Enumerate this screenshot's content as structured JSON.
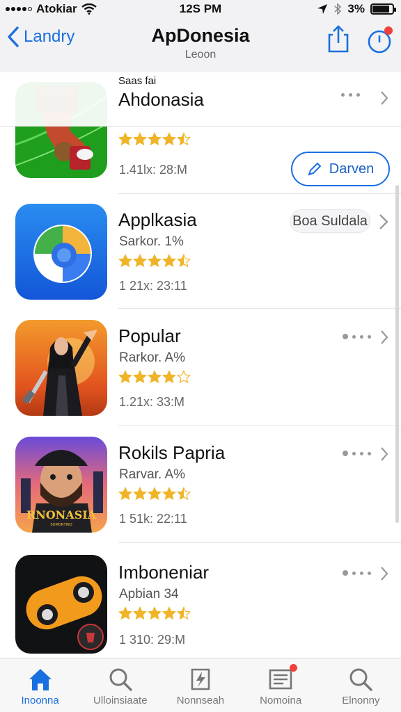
{
  "status_bar": {
    "carrier": "Atokiar",
    "time": "12S PM",
    "battery_text": "3%",
    "battery_level": 0.85
  },
  "nav": {
    "back_label": "Landry",
    "title": "ApDonesia",
    "subtitle": "Leoon"
  },
  "sticky_header": {
    "small_label": "Saas fai",
    "title": "Ahdonasia"
  },
  "apps": [
    {
      "name": "",
      "subtitle": "",
      "meta": "1.41lx: 28:M",
      "rating": 4.5,
      "action": "Darven",
      "icon": "socks-gift-icon"
    },
    {
      "name": "Applkasia",
      "subtitle": "Sarkor. 1%",
      "meta": "1 21x: 23:11",
      "rating": 4.5,
      "action": "Boa Suldala",
      "icon": "browser-swirl-icon"
    },
    {
      "name": "Popular",
      "subtitle": "Rarkor. A%",
      "meta": "1.21x: 33:M",
      "rating": 4,
      "action": "",
      "icon": "sorceress-icon"
    },
    {
      "name": "Rokils Papria",
      "subtitle": "Rarvar. A%",
      "meta": "1 51k: 22:11",
      "rating": 4.5,
      "action": "",
      "icon": "bearded-man-icon",
      "icon_text": "RNONASIA",
      "icon_subtext": "SOMONTINO"
    },
    {
      "name": "Imboneniar",
      "subtitle": "Apbian 34",
      "meta": "1 310: 29:M",
      "rating": 4.5,
      "action": "",
      "icon": "capsule-eyes-icon"
    }
  ],
  "tabs": [
    {
      "label": "Inoonna",
      "icon": "home-icon",
      "active": true
    },
    {
      "label": "Ulloinsiaate",
      "icon": "search-icon",
      "active": false
    },
    {
      "label": "Nonnseah",
      "icon": "pencil-note-icon",
      "active": false
    },
    {
      "label": "Nomoina",
      "icon": "news-list-icon",
      "active": false,
      "badge": true
    },
    {
      "label": "Elnonny",
      "icon": "search-icon",
      "active": false
    }
  ],
  "colors": {
    "accent": "#1a6fe0",
    "star": "#f0b429",
    "badge": "#f0403a"
  }
}
